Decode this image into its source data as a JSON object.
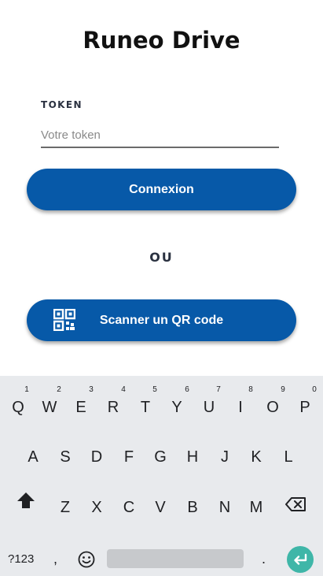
{
  "app": {
    "title": "Runeo Drive"
  },
  "form": {
    "token_label": "TOKEN",
    "token_placeholder": "Votre token",
    "token_value": "",
    "connect_label": "Connexion",
    "or_label": "OU",
    "qr_label": "Scanner un QR code"
  },
  "keyboard": {
    "row1": [
      "Q",
      "W",
      "E",
      "R",
      "T",
      "Y",
      "U",
      "I",
      "O",
      "P"
    ],
    "row1_hints": [
      "1",
      "2",
      "3",
      "4",
      "5",
      "6",
      "7",
      "8",
      "9",
      "0"
    ],
    "row2": [
      "A",
      "S",
      "D",
      "F",
      "G",
      "H",
      "J",
      "K",
      "L"
    ],
    "row3": [
      "Z",
      "X",
      "C",
      "V",
      "B",
      "N",
      "M"
    ],
    "symbols_label": "?123",
    "comma_label": ",",
    "period_label": ".",
    "enter_color": "#3fb6a8"
  },
  "colors": {
    "primary": "#0759a8",
    "keyboard_bg": "#e8eaed"
  }
}
